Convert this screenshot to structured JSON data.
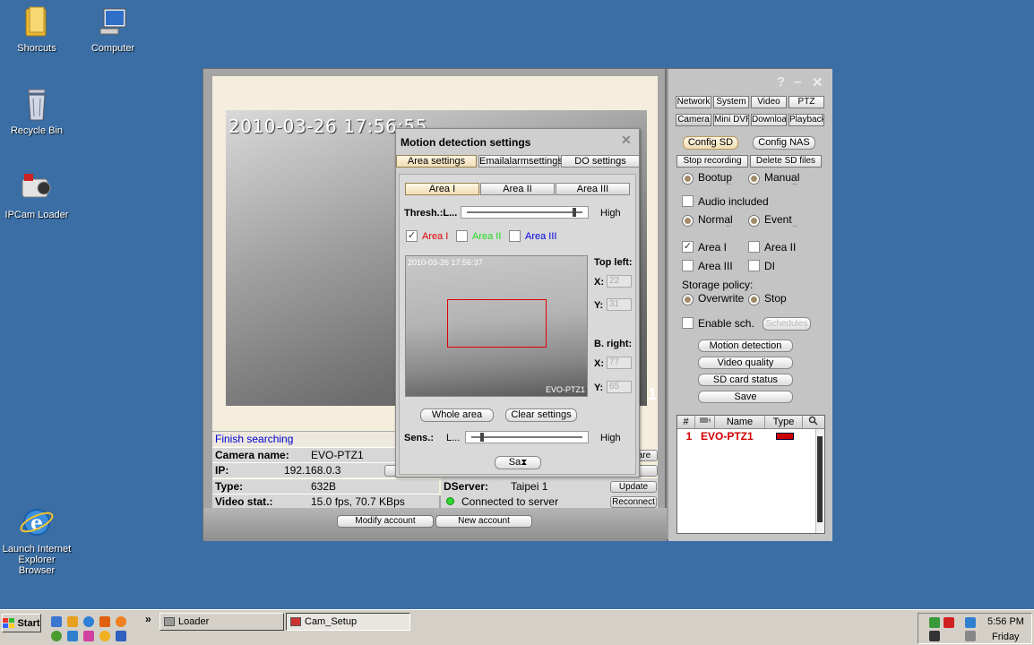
{
  "desktop": {
    "icons": [
      {
        "label": "Shorcuts"
      },
      {
        "label": "Computer"
      },
      {
        "label": "Recycle Bin"
      },
      {
        "label": "IPCam Loader"
      },
      {
        "label": "Launch Internet Explorer Browser"
      }
    ]
  },
  "video": {
    "timestamp": "2010-03-26 17:56:55",
    "channel_number": "1"
  },
  "info": {
    "finish_text": "Finish searching",
    "camera_name_label": "Camera name:",
    "camera_name_value": "EVO-PTZ1",
    "ip_label": "IP:",
    "ip_value": "192.168.0.3",
    "type_label": "Type:",
    "type_value": "632B",
    "video_stat_label": "Video stat.:",
    "video_stat_value": "15.0 fps, 70.7 KBps",
    "dserver_label": "DServer:",
    "dserver_value": "Taipei 1",
    "connected_text": "Connected to server",
    "are_btn": "are",
    "update_btn": "Update",
    "reconnect_btn": "Reconnect"
  },
  "bottom": {
    "modify_account": "Modify account",
    "new_account": "New account"
  },
  "right": {
    "window_controls": {
      "help": "?",
      "minimize": "–",
      "close": "✕"
    },
    "tabs_row1": [
      "Network",
      "System",
      "Video",
      "PTZ"
    ],
    "tabs_row2": [
      "Camera",
      "Mini DVR",
      "Download",
      "Playback"
    ],
    "config_sd": "Config SD",
    "config_nas": "Config NAS",
    "stop_recording": "Stop recording",
    "delete_sd_files": "Delete SD files",
    "bootup_recording": "Bootup recording",
    "manual_recording": "Manual recording",
    "audio_included": "Audio included",
    "normal_recording": "Normal recording",
    "event_recording": "Event recording",
    "area_i": "Area I",
    "area_ii": "Area II",
    "area_iii": "Area III",
    "di": "DI",
    "storage_policy": "Storage policy:",
    "overwrite": "Overwrite",
    "stop": "Stop",
    "enable_sch": "Enable sch.",
    "schedules": "Schedules",
    "motion_detection": "Motion detection",
    "video_quality": "Video quality",
    "sd_card_status": "SD card status",
    "save": "Save",
    "list_headers": {
      "num": "#",
      "name": "Name",
      "type": "Type"
    },
    "list_rows": [
      {
        "num": "1",
        "name": "EVO-PTZ1"
      }
    ]
  },
  "dialog": {
    "title": "Motion detection settings",
    "close": "✕",
    "tabs": [
      "Area settings",
      "Emailalarmsettings",
      "DO settings"
    ],
    "area_tabs": [
      "Area I",
      "Area II",
      "Area III"
    ],
    "thresh_label": "Thresh.:L...",
    "thresh_high": "High",
    "thresh_level": 0.93,
    "checks": [
      {
        "label": "Area I",
        "color": "#e00000",
        "checked": true
      },
      {
        "label": "Area II",
        "color": "#22dd22",
        "checked": false
      },
      {
        "label": "Area III",
        "color": "#0000dd",
        "checked": false
      }
    ],
    "preview_timestamp": "2010-03-26 17:56:37",
    "preview_camera": "EVO-PTZ1",
    "top_left_label": "Top left:",
    "b_right_label": "B. right:",
    "x_label": "X:",
    "y_label": "Y:",
    "top_left_x": "22",
    "top_left_y": "31",
    "b_right_x": "77",
    "b_right_y": "65",
    "whole_area": "Whole area",
    "clear_settings": "Clear settings",
    "sens_label": "Sens.:",
    "sens_l": "L...",
    "sens_high": "High",
    "sens_level": 0.1,
    "save_label": "Sa"
  },
  "taskbar": {
    "start": "Start",
    "chevron": "»",
    "tasks": [
      {
        "label": "Loader"
      },
      {
        "label": "Cam_Setup"
      }
    ],
    "time": "5:56 PM",
    "day": "Friday"
  },
  "colors": {
    "desktop": "#3a6ea5",
    "accent_red": "#d40000",
    "status_green": "#2bd92b"
  }
}
